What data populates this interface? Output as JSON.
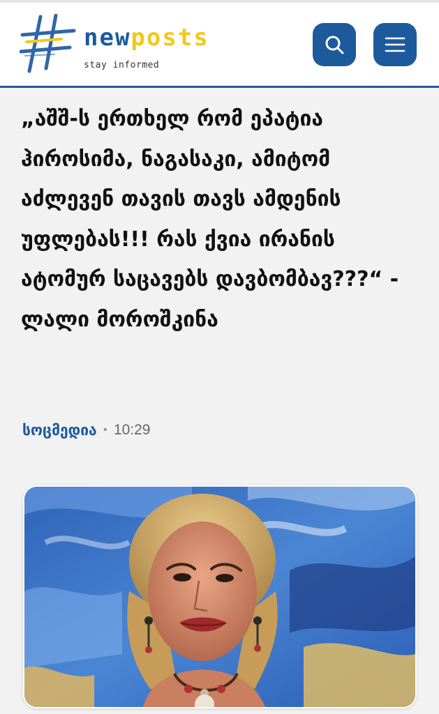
{
  "header": {
    "logo_icon": "hash-logo-icon",
    "logo_name_part1": "new",
    "logo_name_part2": "posts",
    "tagline": "stay informed",
    "search_icon": "search-icon",
    "menu_icon": "hamburger-menu-icon",
    "brand_color": "#1c5a9c",
    "accent_color": "#f2c81a"
  },
  "article": {
    "title": "„აშშ-ს ერთხელ რომ ეპატია ჰიროსიმა, ნაგასაკი, ამიტომ აძლევენ თავის თავს ამდენის უფლებას!!! რას ქვია ირანის ატომურ საცავებს დავბომბავ???“ - ლალი მოროშკინა",
    "category": "სოცმედია",
    "separator": "•",
    "time": "10:29"
  }
}
